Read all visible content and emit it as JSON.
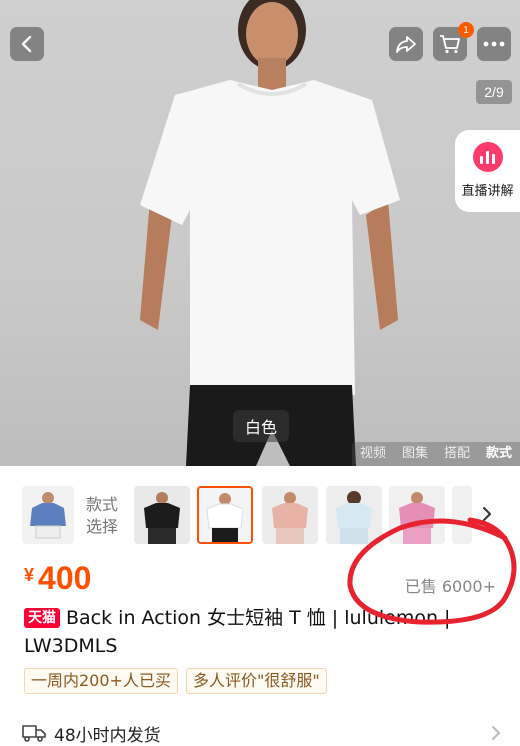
{
  "hero": {
    "color_tag": "白色",
    "page_indicator": "2/9",
    "cart_badge": "1",
    "live_label": "直播讲解",
    "media_tabs": [
      "视频",
      "图集",
      "搭配",
      "款式"
    ],
    "active_media_tab": "款式"
  },
  "styles": {
    "label_line1": "款式",
    "label_line2": "选择"
  },
  "price": {
    "symbol": "¥",
    "value": "400",
    "sold": "已售 6000+"
  },
  "title": {
    "badge": "天猫",
    "text": "Back in Action 女士短袖 T 恤 | lululemon | LW3DMLS"
  },
  "tags": [
    "一周内200+人已买",
    "多人评价\"很舒服\""
  ],
  "shipping": {
    "text": "48小时内发货"
  },
  "colors": {
    "accent": "#ff5000",
    "tmall": "#ff0036",
    "annotation": "#e8232f"
  }
}
